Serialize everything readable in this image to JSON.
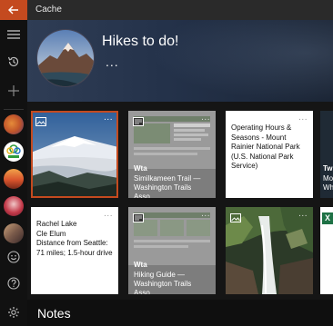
{
  "window": {
    "title": "Cache"
  },
  "header": {
    "title": "Hikes to do!",
    "more": "..."
  },
  "cards": [
    {
      "id": "rainier-photo",
      "more": "..."
    },
    {
      "id": "similkameen",
      "more": "...",
      "site": "Wta",
      "caption": "Similkameen Trail — Washington Trails Asso..."
    },
    {
      "id": "rainier-hours",
      "more": "...",
      "text": "Operating Hours & Seasons - Mount Rainier National Park (U.S. National Park Service)"
    },
    {
      "id": "partial-top",
      "site": "Tw",
      "caption": "Mo Wh"
    },
    {
      "id": "rachel-lake",
      "more": "...",
      "text": "Rachel Lake\nCle Elum\nDistance from Seattle: 71 miles; 1.5-hour drive"
    },
    {
      "id": "hiking-guide",
      "more": "...",
      "site": "Wta",
      "caption": "Hiking Guide — Washington Trails Asso..."
    },
    {
      "id": "waterfall-photo",
      "more": "..."
    },
    {
      "id": "partial-bottom",
      "letter": "X"
    }
  ],
  "footer": {
    "notes_label": "Notes"
  },
  "icons": {
    "back": "back-arrow-icon",
    "menu": "hamburger-icon",
    "history": "history-icon",
    "add": "plus-icon",
    "emoji": "smiley-icon",
    "help": "help-icon",
    "settings": "gear-icon",
    "image": "image-icon"
  },
  "colors": {
    "accent": "#c44a1f"
  }
}
